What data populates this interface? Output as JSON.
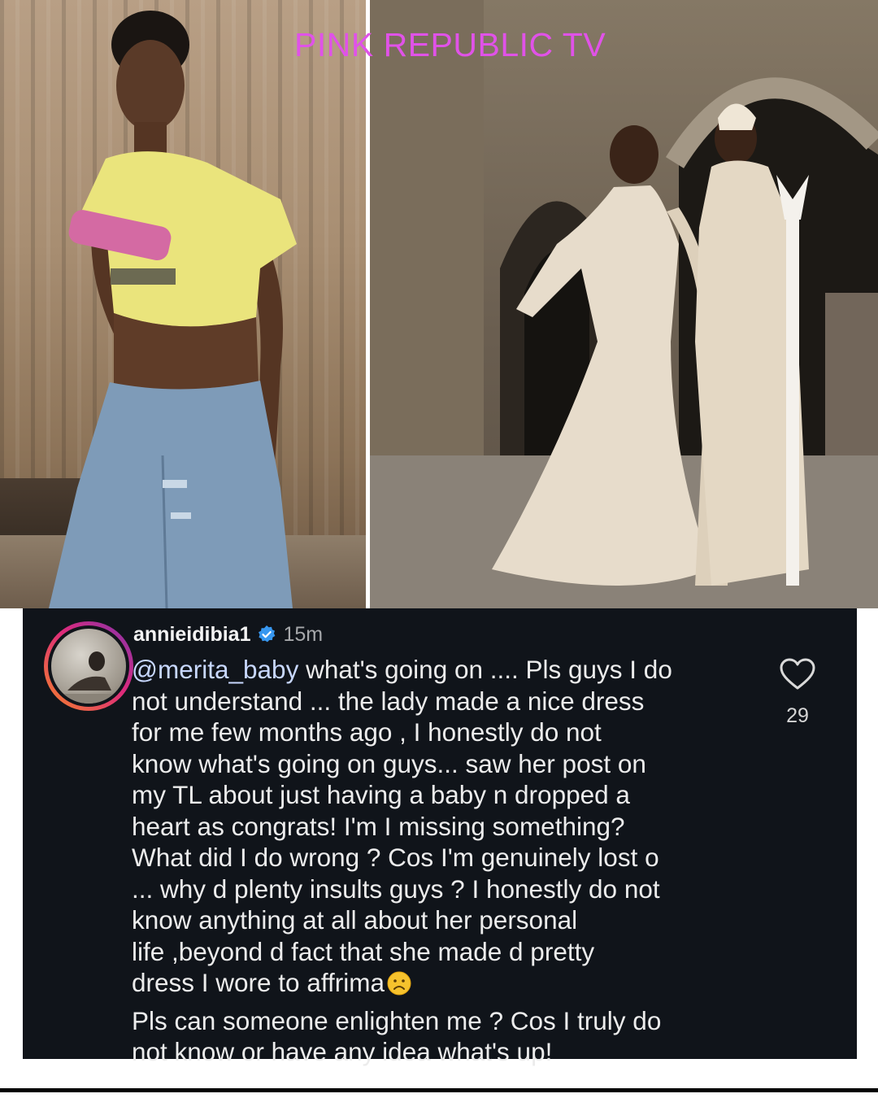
{
  "watermark": "PINK REPUBLIC TV",
  "comment": {
    "username": "annieidibia1",
    "verified": true,
    "time": "15m",
    "mention": "@merita_baby",
    "lines": [
      " what's going on .... Pls guys I do",
      "not understand ... the lady made a nice dress",
      "for me few months ago , I honestly do not",
      "know what's going on guys... saw her post on",
      "my TL about just having a baby n dropped a",
      "heart as congrats!  I'm I missing something?",
      "What did I do wrong ? Cos I'm genuinely lost o",
      "...  why d plenty insults guys ? I honestly do not",
      "know anything at all about her personal",
      "life ,beyond d fact that she made d pretty",
      "dress I wore to affrima"
    ],
    "emoji": "frowning-face-emoji",
    "second_paragraph_lines": [
      "Pls can someone enlighten me ? Cos I truly do",
      "not know or have any idea what's up!"
    ],
    "likes": "29"
  },
  "colors": {
    "card_background": "#10141a",
    "watermark": "#e052e8",
    "verified": "#3797f0",
    "mention": "#c8d8ff"
  },
  "icons": {
    "verified": "verified-badge-icon",
    "like": "heart-outline-icon"
  }
}
